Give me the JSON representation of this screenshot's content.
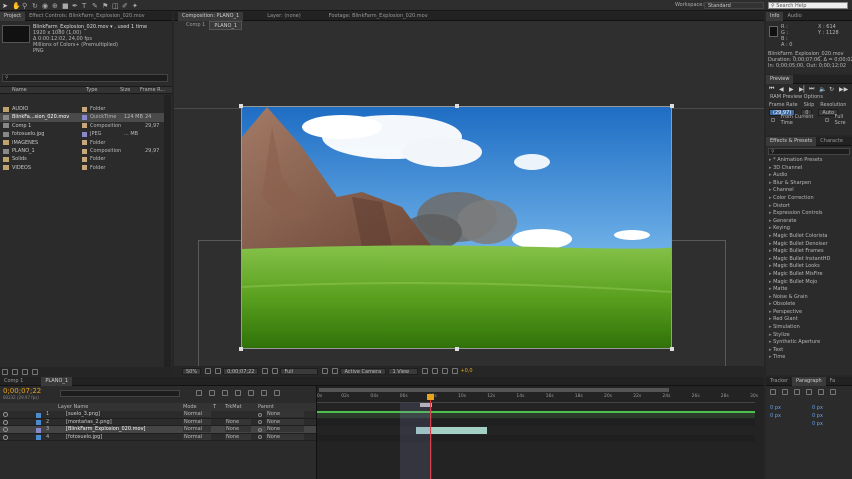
{
  "colors": {
    "accent": "#e8a41a",
    "label_tan": "#c8a77b",
    "label_violet": "#8888cc",
    "label_blue": "#4b8cd0",
    "label_aqua": "#56a3a3",
    "label_green": "#5ca35c",
    "teal_bar": "#a3cfc4"
  },
  "toolbar": {
    "workspace_label": "Workspace:",
    "workspace_value": "Standard",
    "search_placeholder": "Search Help"
  },
  "project": {
    "tab_label": "Project",
    "effect_controls_tab": "Effect Controls: BlinkFarm_Explosion_020.mov",
    "file_name": "BlinkFarm_Explosion_020.mov ▾ , used 1 time",
    "info_lines": [
      "1920 x 1080 (1,00)",
      "Δ 0:00:12:02, 24,00 fps",
      "Millions of Colors+ (Premultiplied)",
      "PNG"
    ],
    "columns": [
      "Name",
      "Type",
      "Size",
      "Frame R..."
    ],
    "items": [
      {
        "name": "AUDIO",
        "type": "Folder",
        "size": "",
        "fps": "",
        "color": "#c8a77b"
      },
      {
        "name": "BlinkFa...sion_020.mov",
        "type": "QuickTime",
        "size": "124 MB",
        "fps": "24",
        "color": "#8888cc",
        "selected": true
      },
      {
        "name": "Comp 1",
        "type": "Composition",
        "size": "",
        "fps": "29,97",
        "color": "#c8a77b"
      },
      {
        "name": "fotosuelo.jpg",
        "type": "JPEG",
        "size": "... MB",
        "fps": "",
        "color": "#8888cc"
      },
      {
        "name": "IMAGENES",
        "type": "Folder",
        "size": "",
        "fps": "",
        "color": "#c8a77b"
      },
      {
        "name": "PLANO_1",
        "type": "Composition",
        "size": "",
        "fps": "29,97",
        "color": "#c8a77b"
      },
      {
        "name": "Solids",
        "type": "Folder",
        "size": "",
        "fps": "",
        "color": "#c8a77b"
      },
      {
        "name": "VIDEOS",
        "type": "Folder",
        "size": "",
        "fps": "",
        "color": "#c8a77b"
      }
    ]
  },
  "viewer": {
    "tabs": [
      "Composition: PLANO_1",
      "Layer: (none)",
      "Footage: BlinkFarm_Explosion_020.mov"
    ],
    "sub_tabs": [
      "Comp 1",
      "PLANO_1"
    ],
    "zoom": "50%",
    "timecode": "0;00;07;22",
    "resolution": "Full",
    "camera": "Active Camera",
    "views": "1 View",
    "exposure": "+0,0"
  },
  "info": {
    "tabs": [
      "Info",
      "Audio"
    ],
    "x_label": "X : 614",
    "y_label": "Y : 1128",
    "rgba": [
      "R :",
      "G :",
      "B :",
      "A : 0"
    ],
    "file": "BlinkFarm_Explosion_020.mov",
    "duration": "Duration: 0;00;07;06, Δ = 0;00;02;28",
    "in_out": "In: 0;00;05;00, Out: 0;00;12;02"
  },
  "preview": {
    "tab": "Preview",
    "ram_label": "RAM Preview Options",
    "frame_rate": "Frame Rate",
    "skip": "Skip",
    "resolution": "Resolution",
    "fps_value": "(29,97)",
    "skip_value": "0",
    "auto": "Auto",
    "from_current": "From Current Time",
    "full_screen": "Full Scre"
  },
  "effects": {
    "tabs": [
      "Effects & Presets",
      "Characte"
    ],
    "items": [
      "* Animation Presets",
      "3D Channel",
      "Audio",
      "Blur & Sharpen",
      "Channel",
      "Color Correction",
      "Distort",
      "Expression Controls",
      "Generate",
      "Keying",
      "Magic Bullet Colorista",
      "Magic Bullet Denoiser",
      "Magic Bullet Frames",
      "Magic Bullet InstantHD",
      "Magic Bullet Looks",
      "Magic Bullet MisFire",
      "Magic Bullet Mojo",
      "Matte",
      "Noise & Grain",
      "Obsolete",
      "Perspective",
      "Red Giant",
      "Simulation",
      "Stylize",
      "Synthetic Aperture",
      "Text",
      "Time"
    ]
  },
  "tracker": {
    "tabs": [
      "Tracker",
      "Paragraph",
      "Fa"
    ],
    "fields": [
      "0 px",
      "0 px",
      "0 px",
      "0 px",
      "0 px"
    ]
  },
  "timeline": {
    "tabs": [
      "Comp 1",
      "PLANO_1"
    ],
    "timecode": "0;00;07;22",
    "frame_label": "00232 (29.97 fps)",
    "columns": {
      "name": "Layer Name",
      "mode": "Mode",
      "t": "T",
      "trkmat": "TrkMat",
      "parent": "Parent"
    },
    "layers": [
      {
        "num": "1",
        "name": "[suelo_3.png]",
        "mode": "Normal",
        "trkmat": "",
        "parent": "None",
        "color": "#4b8cd0"
      },
      {
        "num": "2",
        "name": "[montañas_2.png]",
        "mode": "Normal",
        "trkmat": "None",
        "parent": "None",
        "color": "#4b8cd0"
      },
      {
        "num": "3",
        "name": "[BlinkFarm_Explosion_020.mov]",
        "mode": "Normal",
        "trkmat": "None",
        "parent": "None",
        "color": "#8888cc",
        "selected": true
      },
      {
        "num": "4",
        "name": "[fotosuelo.jpg]",
        "mode": "Normal",
        "trkmat": "None",
        "parent": "None",
        "color": "#4b8cd0"
      }
    ],
    "ruler": [
      "0s",
      "02s",
      "04s",
      "06s",
      "08s",
      "10s",
      "12s",
      "14s",
      "16s",
      "18s",
      "20s",
      "22s",
      "24s",
      "26s",
      "28s",
      "30s"
    ],
    "playhead": 0.258,
    "work_start": 0.236,
    "work_end": 0.262,
    "clip_start": 0.226,
    "clip_end": 0.388
  }
}
